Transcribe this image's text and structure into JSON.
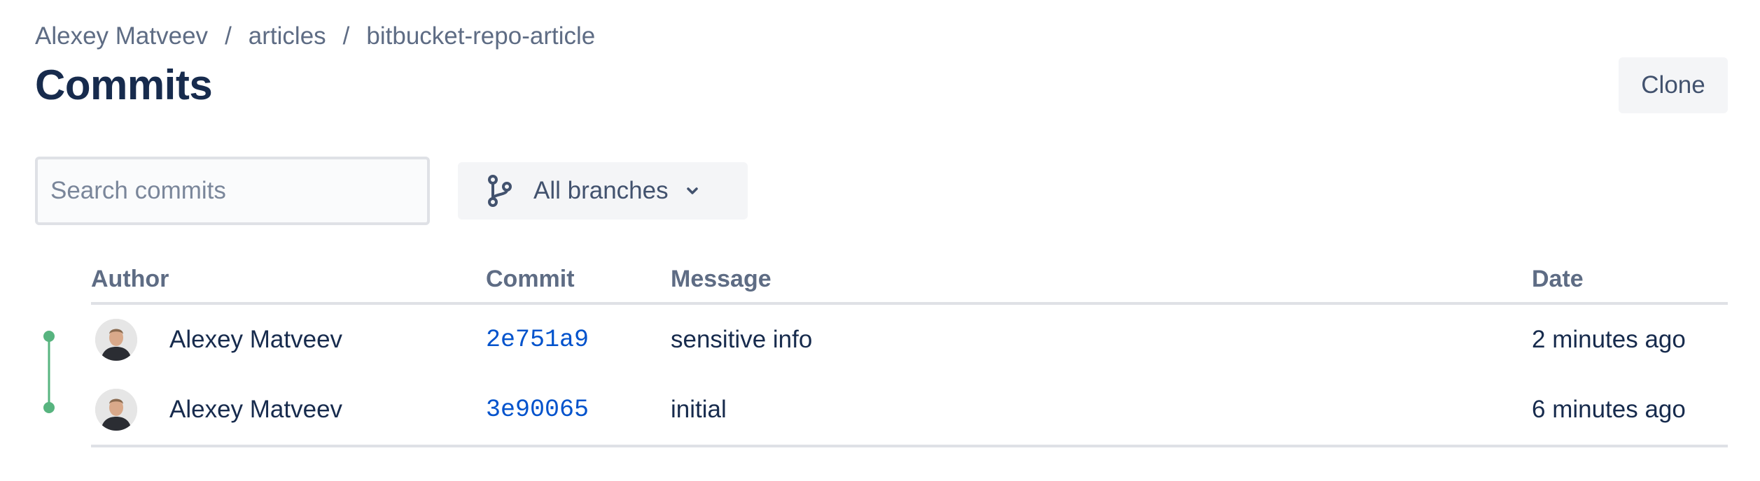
{
  "breadcrumb": {
    "items": [
      "Alexey Matveev",
      "articles",
      "bitbucket-repo-article"
    ],
    "separator": "/"
  },
  "page": {
    "title": "Commits"
  },
  "actions": {
    "clone_label": "Clone"
  },
  "filters": {
    "search_placeholder": "Search commits",
    "branch_label": "All branches",
    "branch_icon": "branch-icon",
    "dropdown_icon": "chevron-down-icon"
  },
  "table": {
    "headers": {
      "author": "Author",
      "commit": "Commit",
      "message": "Message",
      "date": "Date"
    },
    "rows": [
      {
        "author": "Alexey Matveev",
        "commit": "2e751a9",
        "message": "sensitive info",
        "date": "2 minutes ago"
      },
      {
        "author": "Alexey Matveev",
        "commit": "3e90065",
        "message": "initial",
        "date": "6 minutes ago"
      }
    ]
  },
  "colors": {
    "text": "#172b4d",
    "muted": "#5e6c84",
    "link": "#0052cc",
    "graph": "#57b47f",
    "border": "#dfe1e6",
    "button_bg": "#f4f5f7"
  }
}
